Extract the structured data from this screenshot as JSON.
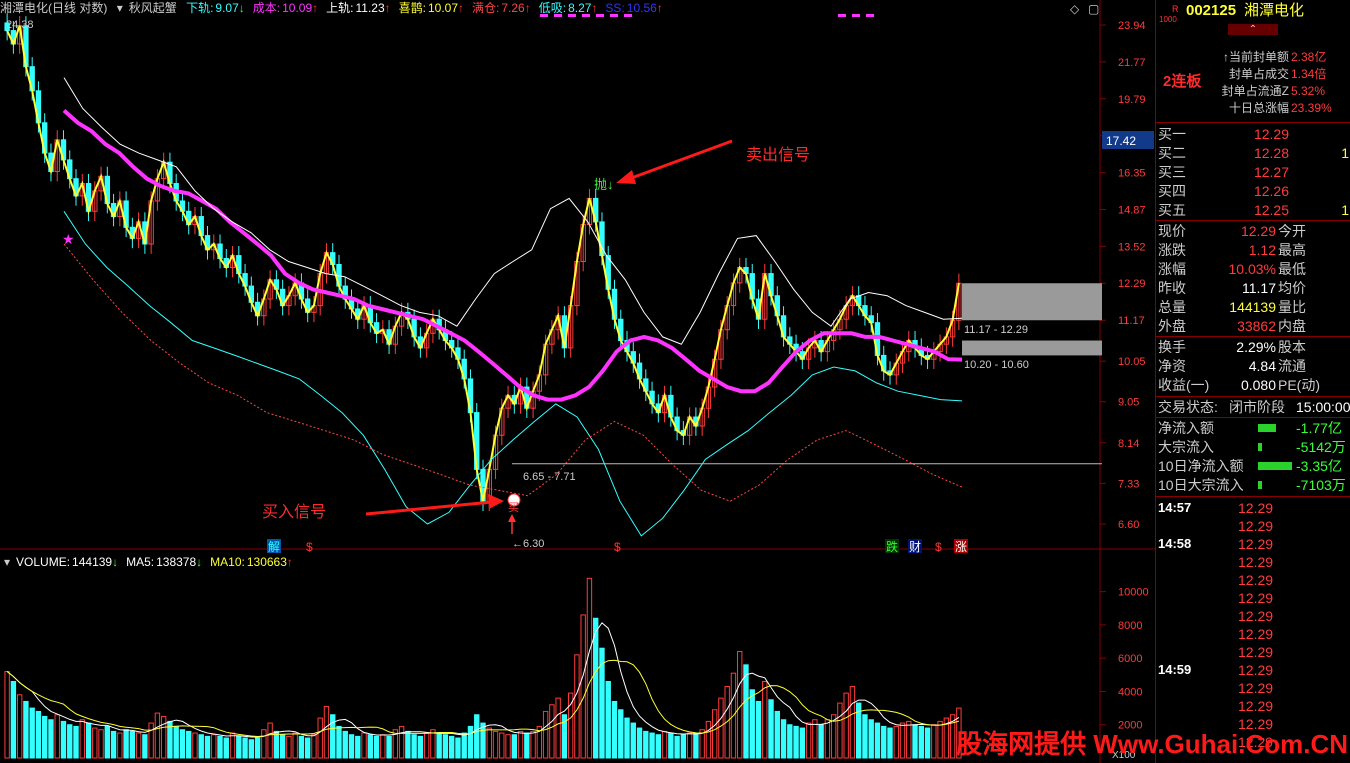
{
  "header": {
    "stock_name": "湘潭电化",
    "mode": "(日线 对数)",
    "indicator": "秋风起蟹",
    "items": [
      {
        "label": "下轨:",
        "value": "9.07",
        "arrow": "↓",
        "color": "#3ff"
      },
      {
        "label": "成本:",
        "value": "10.09",
        "arrow": "↑",
        "color": "#f3f"
      },
      {
        "label": "上轨:",
        "value": "11.23",
        "arrow": "↑",
        "color": "#fff"
      },
      {
        "label": "喜鹊:",
        "value": "10.07",
        "arrow": "↑",
        "color": "#ff3"
      },
      {
        "label": "满仓:",
        "value": "7.26",
        "arrow": "↑",
        "color": "#f44"
      },
      {
        "label": "低吸:",
        "value": "8.27",
        "arrow": "↑",
        "color": "#3ff"
      },
      {
        "label": "SS:",
        "value": "10.56",
        "arrow": "↑",
        "color": "#33f"
      }
    ]
  },
  "annotations": {
    "sell_signal": "卖出信号",
    "buy_signal": "买入信号",
    "sell_mark": "抛↓",
    "buy_mark": "买",
    "low_label": "←6.30",
    "high_label": "24.38",
    "range_low": "6.65 - 7.71",
    "range_mid": "11.17 - 12.29",
    "range_bot": "10.20 - 10.60",
    "current_price_tag": "17.42",
    "bottom_marks": [
      "解",
      "$",
      "$",
      "跌",
      "财",
      "$",
      "涨"
    ]
  },
  "volume_header": {
    "items": [
      {
        "label": "VOLUME:",
        "value": "144139",
        "arrow": "↓",
        "color": "#fff"
      },
      {
        "label": "MA5:",
        "value": "138378",
        "arrow": "↓",
        "color": "#fff"
      },
      {
        "label": "MA10:",
        "value": "130663",
        "arrow": "↑",
        "color": "#ff3"
      }
    ]
  },
  "price_axis": [
    "23.94",
    "21.77",
    "19.79",
    "17.99",
    "16.35",
    "14.87",
    "13.52",
    "12.29",
    "11.17",
    "10.05",
    "9.05",
    "8.14",
    "7.33",
    "6.60"
  ],
  "volume_axis": [
    "10000",
    "8000",
    "6000",
    "4000",
    "2000"
  ],
  "volume_unit": "X100",
  "panel": {
    "code_prefix": "R",
    "code_sub": "1000",
    "code": "002125",
    "name": "湘潭电化",
    "streak": "2连板",
    "seal_stats": [
      {
        "label": "↑当前封单额",
        "value": "2.38亿"
      },
      {
        "label": "封单占成交",
        "value": "1.34倍"
      },
      {
        "label": "封单占流通Z",
        "value": "5.32%"
      },
      {
        "label": "十日总涨幅",
        "value": "23.39%"
      }
    ],
    "bids": [
      {
        "label": "买一",
        "price": "12.29",
        "vol": ""
      },
      {
        "label": "买二",
        "price": "12.28",
        "vol": "1"
      },
      {
        "label": "买三",
        "price": "12.27",
        "vol": ""
      },
      {
        "label": "买四",
        "price": "12.26",
        "vol": ""
      },
      {
        "label": "买五",
        "price": "12.25",
        "vol": "1"
      }
    ],
    "quote": [
      {
        "l1": "现价",
        "v": "12.29",
        "c": "red",
        "l2": "今开"
      },
      {
        "l1": "涨跌",
        "v": "1.12",
        "c": "red",
        "l2": "最高"
      },
      {
        "l1": "涨幅",
        "v": "10.03%",
        "c": "red",
        "l2": "最低"
      },
      {
        "l1": "昨收",
        "v": "11.17",
        "c": "wht",
        "l2": "均价"
      },
      {
        "l1": "总量",
        "v": "144139",
        "c": "yel",
        "l2": "量比"
      },
      {
        "l1": "外盘",
        "v": "33862",
        "c": "red",
        "l2": "内盘"
      }
    ],
    "quote2": [
      {
        "l1": "换手",
        "v": "2.29%",
        "c": "wht",
        "l2": "股本"
      },
      {
        "l1": "净资",
        "v": "4.84",
        "c": "wht",
        "l2": "流通"
      },
      {
        "l1": "收益(一)",
        "v": "0.080",
        "c": "wht",
        "l2": "PE(动)"
      }
    ],
    "trade_status_label": "交易状态:",
    "trade_status_value": "闭市阶段",
    "trade_time": "15:00:00",
    "flows": [
      {
        "label": "净流入额",
        "value": "-1.77亿",
        "bar": 18
      },
      {
        "label": "大宗流入",
        "value": "-5142万",
        "bar": 4
      },
      {
        "label": "10日净流入额",
        "value": "-3.35亿",
        "bar": 34
      },
      {
        "label": "10日大宗流入",
        "value": "-7103万",
        "bar": 4
      }
    ],
    "ticks": [
      {
        "time": "14:57",
        "prices": [
          "12.29",
          "12.29"
        ]
      },
      {
        "time": "14:58",
        "prices": [
          "12.29",
          "12.29",
          "12.29",
          "12.29",
          "12.29",
          "12.29",
          "12.29"
        ]
      },
      {
        "time": "14:59",
        "prices": [
          "12.29",
          "12.29",
          "12.29",
          "12.29",
          "12.29"
        ]
      }
    ]
  },
  "watermark": "股海网提供 Www.Guhai.Com.CN",
  "chart_data": {
    "type": "candlestick",
    "title": "湘潭电化 (日线 对数)",
    "y_scale": "log",
    "ylim": [
      6.3,
      24.38
    ],
    "close": [
      23.6,
      22.8,
      23.9,
      21.5,
      20.2,
      18.6,
      17.2,
      16.4,
      17.8,
      16.9,
      16.1,
      15.4,
      15.9,
      14.8,
      15.6,
      16.2,
      15.1,
      14.6,
      15.2,
      14.2,
      13.8,
      14.4,
      13.6,
      15.2,
      16.1,
      16.8,
      15.9,
      15.2,
      14.8,
      14.3,
      14.6,
      13.9,
      13.4,
      13.6,
      13.1,
      12.8,
      13.2,
      12.6,
      12.2,
      11.7,
      11.3,
      11.8,
      12.4,
      12.1,
      11.6,
      11.9,
      12.3,
      11.8,
      11.4,
      11.6,
      12.6,
      13.3,
      12.9,
      12.2,
      11.8,
      11.5,
      11.2,
      11.6,
      11.1,
      10.8,
      10.9,
      10.5,
      11.0,
      11.4,
      11.2,
      10.7,
      10.4,
      10.8,
      11.2,
      10.9,
      10.6,
      10.4,
      10.1,
      9.6,
      8.8,
      7.6,
      7.0,
      7.6,
      8.3,
      8.9,
      9.2,
      9.0,
      9.4,
      8.9,
      9.3,
      9.7,
      10.5,
      10.9,
      11.3,
      10.4,
      11.6,
      13.0,
      14.3,
      15.3,
      14.4,
      13.2,
      12.1,
      11.2,
      10.6,
      10.3,
      10.0,
      9.6,
      9.3,
      9.0,
      8.8,
      9.2,
      8.7,
      8.4,
      8.3,
      8.7,
      8.5,
      8.9,
      9.4,
      10.1,
      10.9,
      11.6,
      12.3,
      12.8,
      12.6,
      11.8,
      11.2,
      12.6,
      11.9,
      11.3,
      10.7,
      10.5,
      10.3,
      10.1,
      10.4,
      10.6,
      10.3,
      10.6,
      10.9,
      11.2,
      11.6,
      11.9,
      11.6,
      11.3,
      11.1,
      10.2,
      9.8,
      9.7,
      10.0,
      10.3,
      10.6,
      10.4,
      10.2,
      10.1,
      10.3,
      10.5,
      10.7,
      11.17,
      12.29
    ],
    "series": [
      {
        "name": "成本",
        "color": "#ff33ff",
        "values": [
          19.2,
          18.6,
          18.2,
          17.6,
          17.2,
          16.6,
          16.1,
          15.8,
          15.6,
          15.5,
          15.2,
          14.9,
          14.4,
          14.0,
          13.6,
          13.2,
          12.6,
          12.3,
          12.1,
          12.0,
          11.9,
          11.8,
          11.6,
          11.5,
          11.4,
          11.3,
          11.2,
          11.0,
          10.8,
          10.6,
          10.3,
          10.0,
          9.7,
          9.4,
          9.2,
          9.1,
          9.1,
          9.2,
          9.4,
          9.8,
          10.3,
          10.6,
          10.7,
          10.6,
          10.4,
          10.1,
          9.8,
          9.6,
          9.4,
          9.3,
          9.3,
          9.5,
          9.9,
          10.3,
          10.6,
          10.8,
          10.8,
          10.8,
          10.7,
          10.7,
          10.6,
          10.5,
          10.4,
          10.3,
          10.1,
          10.09
        ]
      },
      {
        "name": "上轨",
        "color": "#ffffff",
        "values": [
          20.9,
          19.3,
          18.4,
          17.6,
          17.2,
          16.9,
          16.6,
          15.6,
          14.9,
          14.4,
          14.0,
          13.4,
          13.0,
          12.8,
          12.6,
          12.5,
          12.2,
          11.9,
          11.6,
          11.4,
          11.3,
          11.0,
          11.8,
          12.6,
          13.0,
          13.4,
          14.9,
          15.3,
          14.4,
          13.2,
          12.4,
          11.4,
          10.7,
          10.5,
          11.4,
          12.6,
          13.8,
          13.9,
          13.0,
          12.1,
          11.4,
          11.0,
          11.8,
          12.0,
          11.9,
          11.6,
          11.4,
          11.2,
          11.23
        ]
      },
      {
        "name": "下轨",
        "color": "#33ffff",
        "values": [
          14.8,
          13.6,
          12.8,
          12.2,
          11.6,
          11.1,
          10.6,
          10.4,
          10.2,
          10.0,
          9.8,
          9.6,
          9.2,
          8.8,
          8.3,
          7.6,
          6.9,
          6.6,
          6.8,
          7.3,
          7.8,
          8.2,
          8.6,
          9.0,
          8.7,
          8.0,
          7.0,
          6.4,
          6.7,
          7.2,
          7.8,
          8.1,
          8.4,
          8.8,
          9.2,
          9.7,
          9.9,
          9.8,
          9.5,
          9.3,
          9.2,
          9.1,
          9.07
        ]
      },
      {
        "name": "满仓",
        "color": "#ff4444",
        "values": [
          13.6,
          12.4,
          11.4,
          10.6,
          10.0,
          9.5,
          9.2,
          8.8,
          8.6,
          8.4,
          8.2,
          7.9,
          7.7,
          7.5,
          7.3,
          7.2,
          7.1,
          7.5,
          8.2,
          8.6,
          8.3,
          7.7,
          7.2,
          7.0,
          7.3,
          7.8,
          8.2,
          8.4,
          8.1,
          7.8,
          7.5,
          7.26
        ]
      }
    ],
    "volume": {
      "ma5": 138378,
      "ma10": 130663,
      "last": 144139,
      "ylim": [
        0,
        11000
      ],
      "values": [
        5200,
        4600,
        3800,
        3400,
        3000,
        2800,
        2500,
        2300,
        2600,
        2200,
        2000,
        1900,
        2300,
        2100,
        1800,
        1700,
        1900,
        1600,
        1500,
        1700,
        1600,
        1500,
        1400,
        2100,
        2700,
        2500,
        2200,
        1900,
        1700,
        1600,
        1500,
        1400,
        1300,
        1400,
        1300,
        1200,
        1500,
        1300,
        1200,
        1100,
        1200,
        1700,
        2100,
        1600,
        1400,
        1300,
        1500,
        1300,
        1200,
        1400,
        2400,
        3100,
        2600,
        1900,
        1600,
        1400,
        1300,
        1500,
        1400,
        1300,
        1400,
        1300,
        1700,
        1900,
        1600,
        1400,
        1300,
        1500,
        1700,
        1500,
        1400,
        1300,
        1200,
        1500,
        1900,
        2600,
        2100,
        1800,
        1600,
        1500,
        1400,
        1400,
        1600,
        1500,
        1600,
        1900,
        2800,
        3200,
        3600,
        2600,
        3900,
        6200,
        8600,
        10800,
        8400,
        6600,
        4600,
        3400,
        2900,
        2400,
        2100,
        1800,
        1600,
        1500,
        1400,
        1600,
        1500,
        1300,
        1400,
        1500,
        1500,
        1700,
        2200,
        2900,
        3600,
        4300,
        5100,
        6400,
        5600,
        4100,
        3400,
        4600,
        3500,
        2800,
        2300,
        2000,
        1900,
        1800,
        2100,
        2300,
        2000,
        2300,
        2600,
        3300,
        3900,
        4300,
        3300,
        2600,
        2300,
        2100,
        1900,
        1800,
        1900,
        2100,
        2200,
        2000,
        1900,
        1800,
        2000,
        2200,
        2400,
        2600,
        3000
      ]
    }
  }
}
